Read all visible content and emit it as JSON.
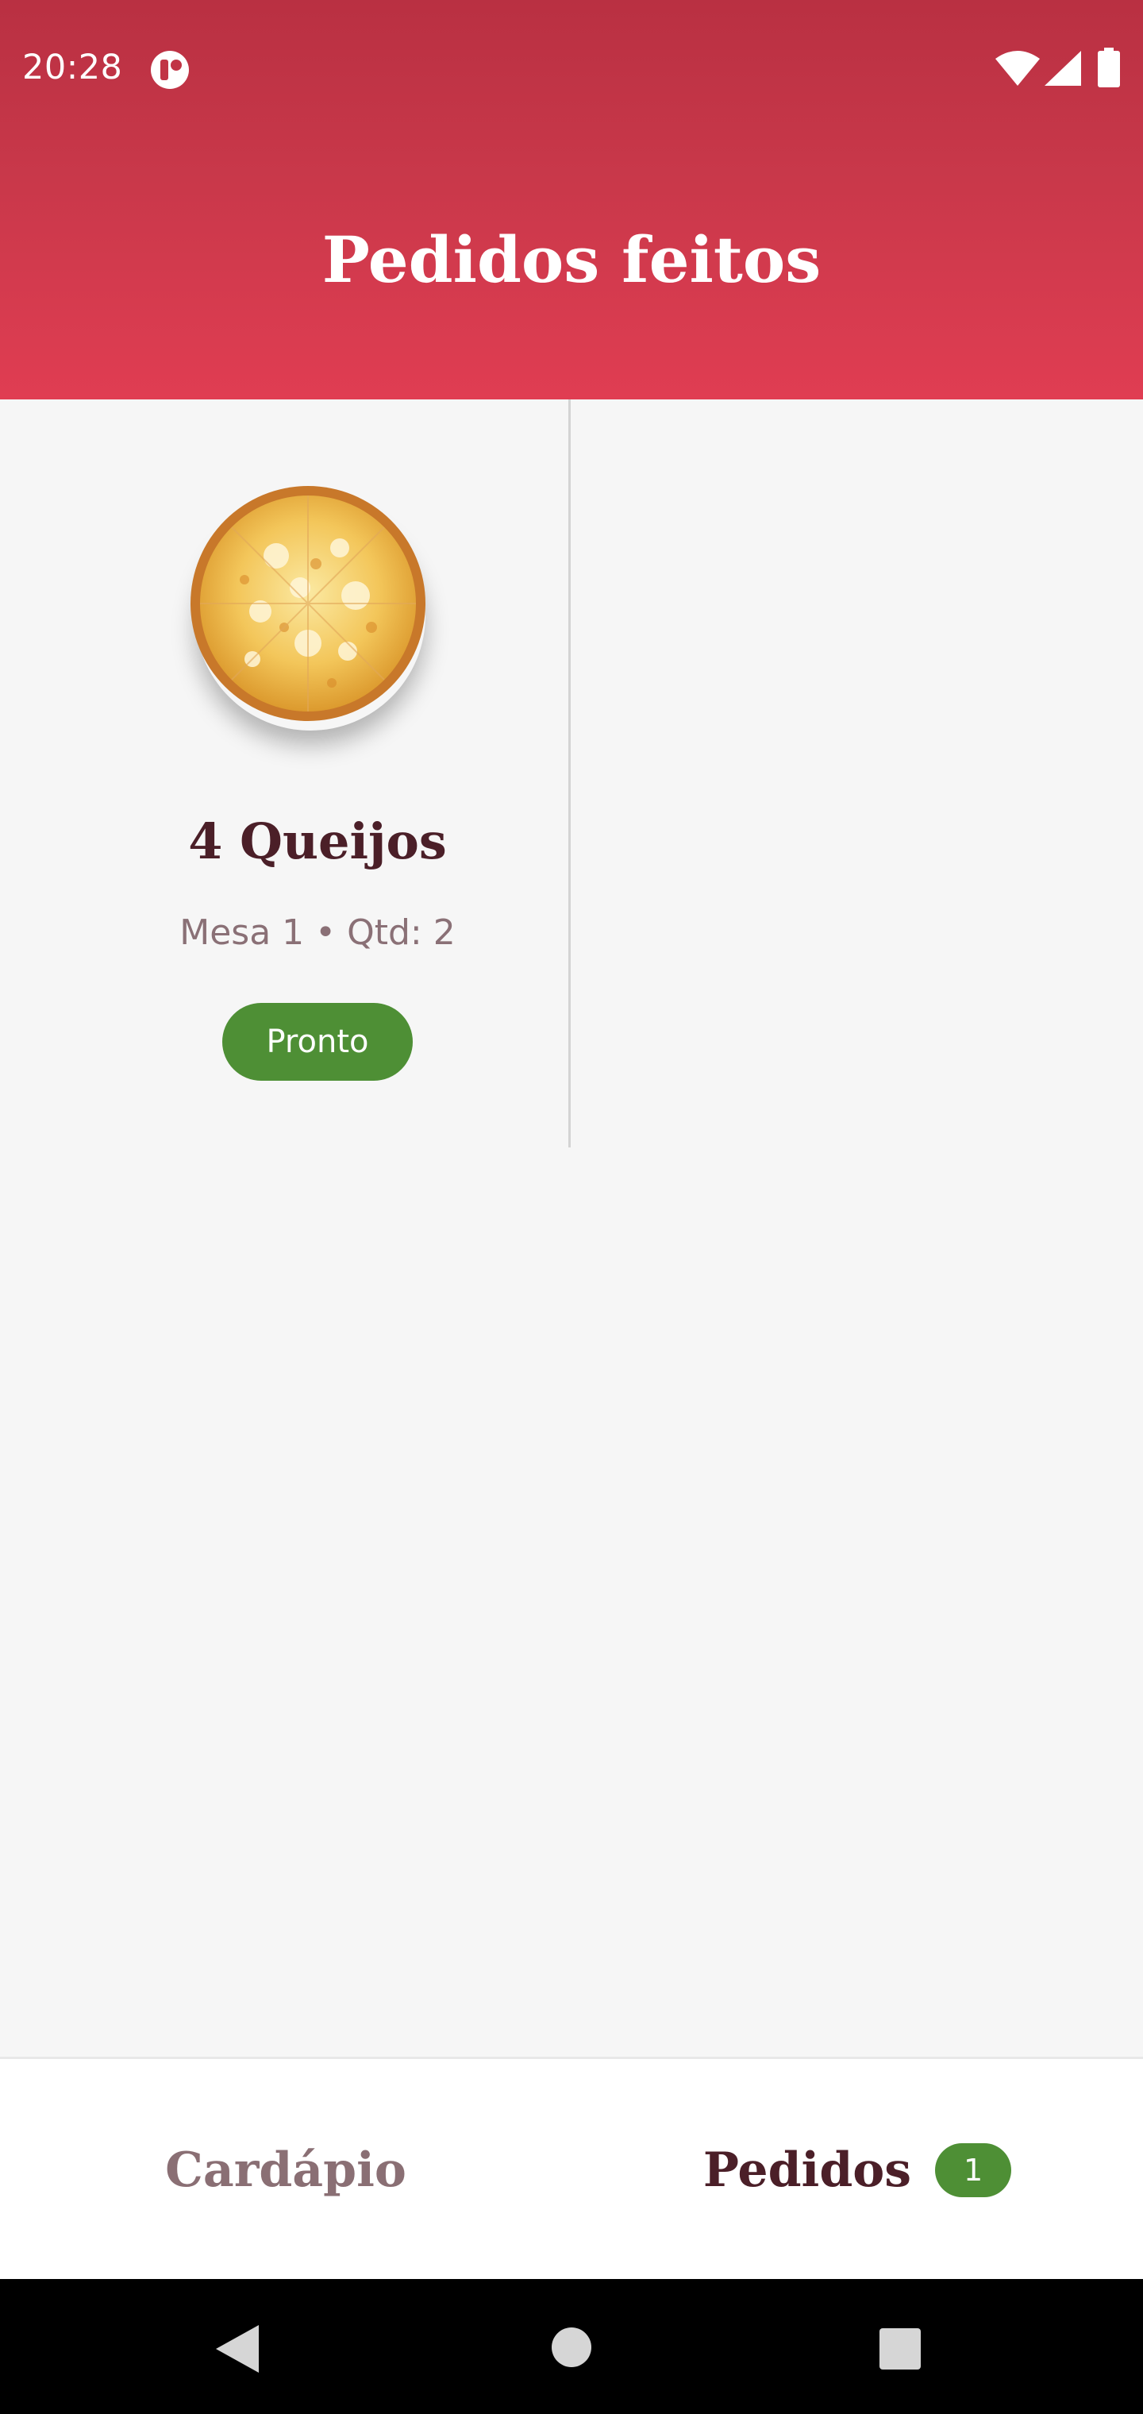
{
  "status_bar": {
    "time": "20:28",
    "icons": [
      "notification-badge-icon",
      "wifi-icon",
      "cell-signal-icon",
      "battery-icon"
    ]
  },
  "header": {
    "title": "Pedidos feitos",
    "gradient_colors": [
      "#b93042",
      "#e03d52"
    ]
  },
  "orders": [
    {
      "image": "pizza-four-cheese",
      "name": "4 Queijos",
      "meta": "Mesa 1 • Qtd: 2",
      "status": "Pronto",
      "status_color": "#4e8f35"
    }
  ],
  "bottom_nav": {
    "tabs": [
      {
        "label": "Cardápio",
        "active": false
      },
      {
        "label": "Pedidos",
        "active": true,
        "badge": "1"
      }
    ]
  },
  "system_nav": {
    "icons": [
      "back-icon",
      "home-icon",
      "recents-icon"
    ]
  }
}
